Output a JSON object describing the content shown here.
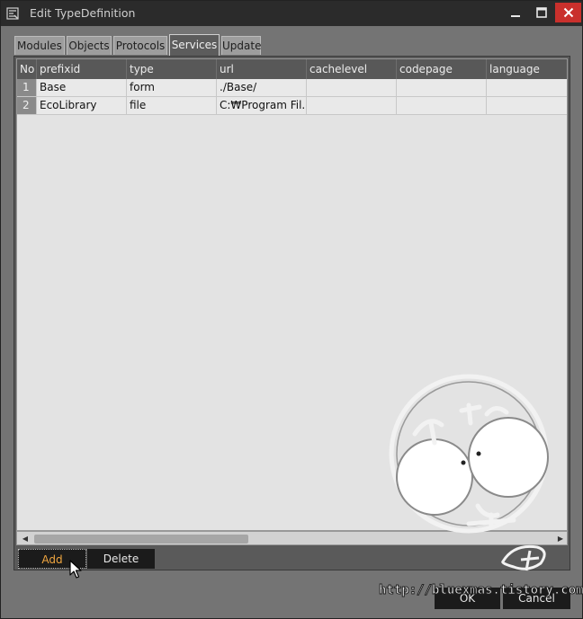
{
  "window": {
    "title": "Edit TypeDefinition",
    "icons": {
      "app": "type-definition-icon",
      "minimize": "minimize-icon",
      "maximize": "maximize-icon",
      "close": "close-icon"
    },
    "colors": {
      "close": "#c9302c",
      "accent": "#f0a640"
    }
  },
  "tabs": [
    {
      "label": "Modules"
    },
    {
      "label": "Objects"
    },
    {
      "label": "Protocols"
    },
    {
      "label": "Services",
      "active": true
    },
    {
      "label": "Update"
    }
  ],
  "grid": {
    "columns": [
      "No",
      "prefixid",
      "type",
      "url",
      "cachelevel",
      "codepage",
      "language"
    ],
    "rows": [
      {
        "no": "1",
        "prefixid": "Base",
        "type": "form",
        "url": "./Base/",
        "cachelevel": "",
        "codepage": "",
        "language": ""
      },
      {
        "no": "2",
        "prefixid": "EcoLibrary",
        "type": "file",
        "url": "C:₩Program Fil...",
        "cachelevel": "",
        "codepage": "",
        "language": ""
      }
    ]
  },
  "buttons": {
    "add": "Add",
    "delete": "Delete",
    "ok": "OK",
    "cancel": "Cancel"
  },
  "watermark": {
    "url": "http://bluexmas.tistory.com/"
  }
}
